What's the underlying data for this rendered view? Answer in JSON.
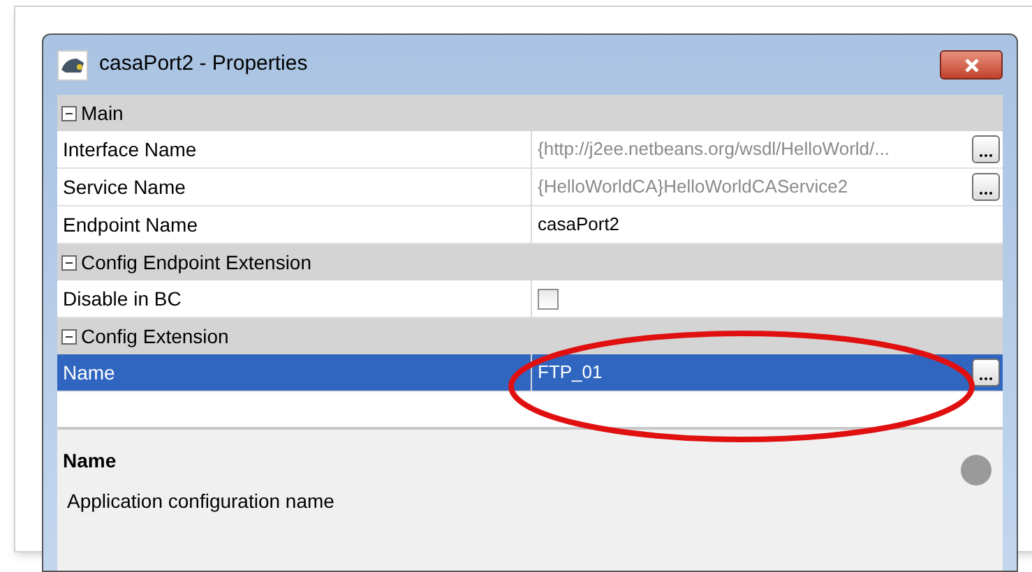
{
  "window": {
    "title": "casaPort2 - Properties"
  },
  "sections": [
    {
      "title": "Main",
      "expanded": true,
      "rows": [
        {
          "kind": "text",
          "name": "Interface Name",
          "value": "{http://j2ee.netbeans.org/wsdl/HelloWorld/...",
          "disabled": true,
          "has_button": true,
          "selected": false
        },
        {
          "kind": "text",
          "name": "Service Name",
          "value": "{HelloWorldCA}HelloWorldCAService2",
          "disabled": true,
          "has_button": true,
          "selected": false
        },
        {
          "kind": "text",
          "name": "Endpoint Name",
          "value": "casaPort2",
          "disabled": false,
          "has_button": false,
          "selected": false
        }
      ]
    },
    {
      "title": "Config Endpoint Extension",
      "expanded": true,
      "rows": [
        {
          "kind": "checkbox",
          "name": "Disable in BC",
          "checked": false,
          "selected": false
        }
      ]
    },
    {
      "title": "Config Extension",
      "expanded": true,
      "rows": [
        {
          "kind": "text",
          "name": "Name",
          "value": "FTP_01",
          "disabled": false,
          "has_button": true,
          "selected": true
        }
      ]
    }
  ],
  "description": {
    "title": "Name",
    "text": "Application configuration name"
  }
}
